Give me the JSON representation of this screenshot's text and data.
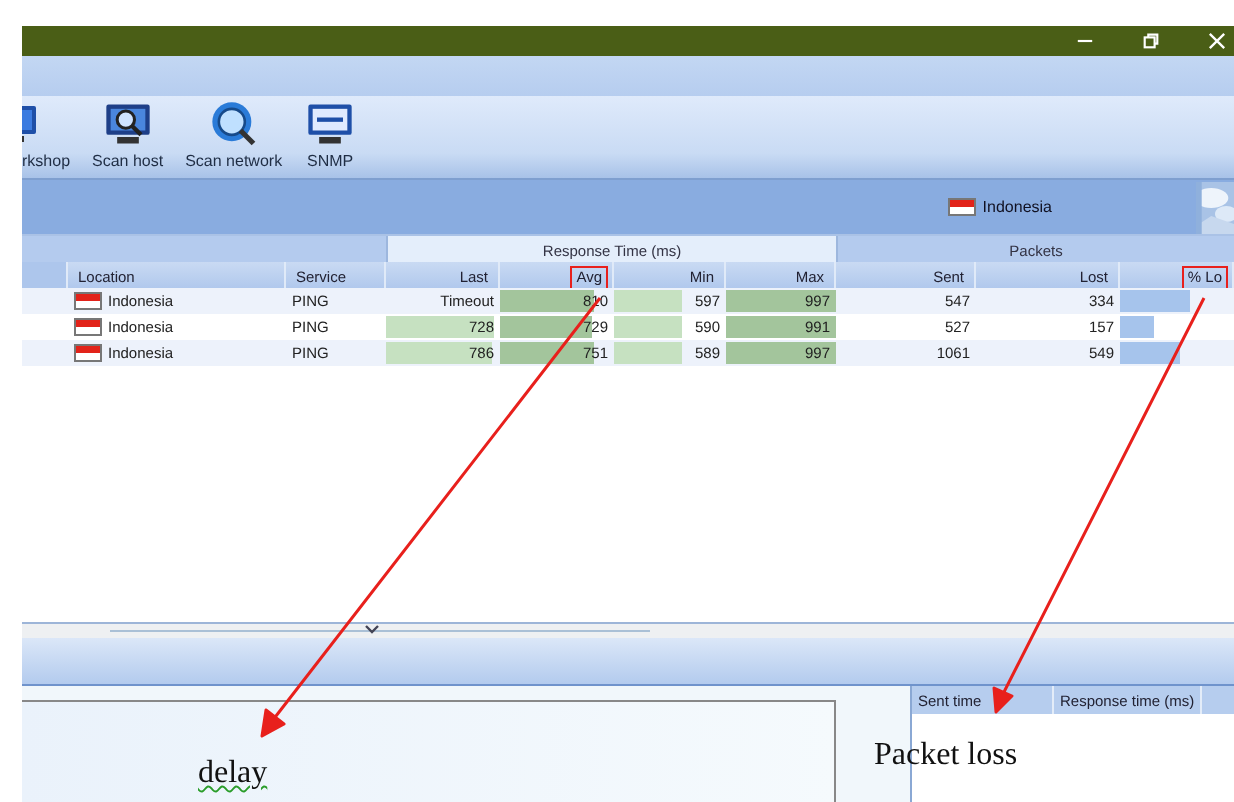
{
  "toolbar": {
    "items": [
      {
        "label": "rkshop",
        "kind": "monitor"
      },
      {
        "label": "Scan host",
        "kind": "scan-host"
      },
      {
        "label": "Scan network",
        "kind": "globe"
      },
      {
        "label": "SNMP",
        "kind": "snmp"
      }
    ]
  },
  "location_bar": {
    "country": "Indonesia"
  },
  "table": {
    "groups": [
      "Response Time (ms)",
      "Packets"
    ],
    "columns": [
      {
        "label": "Location",
        "kind": "text",
        "marked": false
      },
      {
        "label": "Service",
        "kind": "text",
        "marked": false
      },
      {
        "label": "Last",
        "kind": "number",
        "color": "#c6e1c1",
        "marked": false
      },
      {
        "label": "Avg",
        "kind": "number",
        "color": "#a3c59c",
        "marked": true
      },
      {
        "label": "Min",
        "kind": "number",
        "color": "#c6e1c1",
        "marked": false
      },
      {
        "label": "Max",
        "kind": "number",
        "color": "#a3c59c",
        "marked": false
      },
      {
        "label": "Sent",
        "kind": "number",
        "marked": false
      },
      {
        "label": "Lost",
        "kind": "number",
        "marked": false
      },
      {
        "label": "% Lo",
        "kind": "number",
        "color": "#a6c4ec",
        "marked": true
      }
    ],
    "rows": [
      {
        "cells": [
          {
            "text": "Indonesia"
          },
          {
            "text": "PING"
          },
          {
            "text": "Timeout"
          },
          {
            "text": "810",
            "level": 0.82
          },
          {
            "text": "597",
            "level": 0.6
          },
          {
            "text": "997",
            "level": 1
          },
          {
            "text": "547"
          },
          {
            "text": "334"
          },
          {
            "level": 0.61
          }
        ]
      },
      {
        "cells": [
          {
            "text": "Indonesia"
          },
          {
            "text": "PING"
          },
          {
            "text": "728",
            "level": 0.95
          },
          {
            "text": "729",
            "level": 0.8
          },
          {
            "text": "590",
            "level": 0.6
          },
          {
            "text": "991",
            "level": 1
          },
          {
            "text": "527"
          },
          {
            "text": "157"
          },
          {
            "level": 0.3
          }
        ]
      },
      {
        "cells": [
          {
            "text": "Indonesia"
          },
          {
            "text": "PING"
          },
          {
            "text": "786",
            "level": 0.93
          },
          {
            "text": "751",
            "level": 0.82
          },
          {
            "text": "589",
            "level": 0.6
          },
          {
            "text": "997",
            "level": 1
          },
          {
            "text": "1061"
          },
          {
            "text": "549"
          },
          {
            "level": 0.52
          }
        ]
      }
    ]
  },
  "detail_list": {
    "columns": [
      "Sent time",
      "Response time (ms)"
    ]
  },
  "annotations": [
    {
      "text": "delay",
      "misspelled": true
    },
    {
      "text": "Packet loss",
      "misspelled": false
    }
  ]
}
